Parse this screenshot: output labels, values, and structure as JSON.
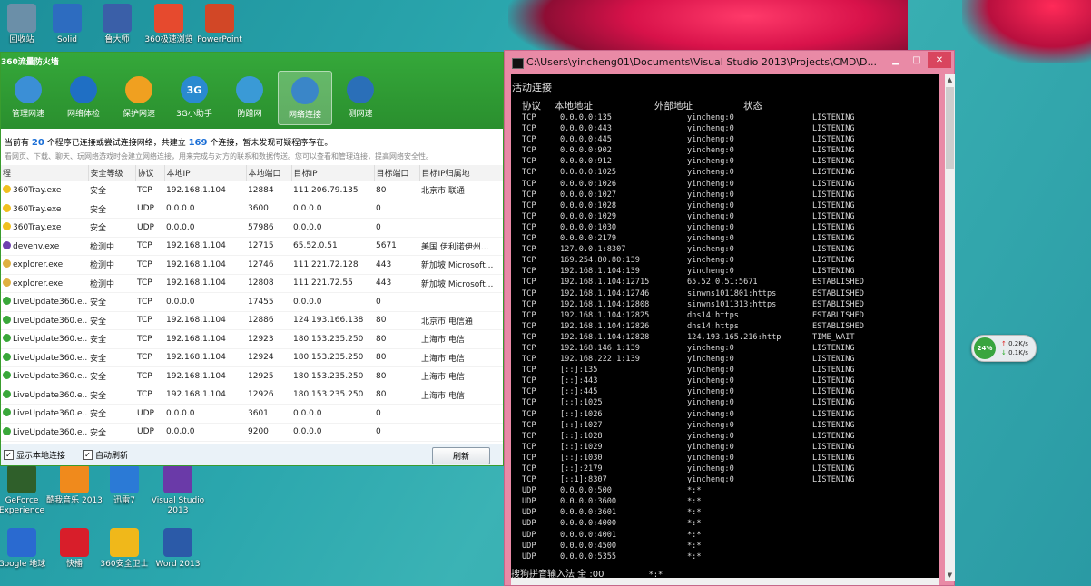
{
  "desktop_icons_top": [
    {
      "label": "回收站",
      "icon": "recycle-bin-icon",
      "color": "#6b8fa8"
    },
    {
      "label": "Solid",
      "icon": "solid-doc-icon",
      "color": "#2d6cc0"
    },
    {
      "label": "鲁大师",
      "icon": "ludashi-icon",
      "color": "#3a5fa8"
    },
    {
      "label": "360极速浏览",
      "icon": "browser-icon",
      "color": "#e64a2e"
    },
    {
      "label": "PowerPoint",
      "icon": "powerpoint-icon",
      "color": "#d24726"
    }
  ],
  "desktop_icons_bottom": [
    {
      "label": "GeForce Experience",
      "icon": "geforce-icon",
      "color": "#2f5f2a"
    },
    {
      "label": "酷我音乐 2013",
      "icon": "kuwo-icon",
      "color": "#f08a1c"
    },
    {
      "label": "迅雷7",
      "icon": "xunlei-icon",
      "color": "#2b7ad6"
    },
    {
      "label": "Visual Studio 2013",
      "icon": "visual-studio-icon",
      "color": "#6a3aa8"
    },
    {
      "label": "Google 地球",
      "icon": "google-earth-icon",
      "color": "#2a6ad0"
    },
    {
      "label": "快播",
      "icon": "kuaibo-icon",
      "color": "#d81e2a"
    },
    {
      "label": "360安全卫士",
      "icon": "360-security-icon",
      "color": "#f0b81a"
    },
    {
      "label": "Word 2013",
      "icon": "word-icon",
      "color": "#2b5aa8"
    }
  ],
  "firewall": {
    "title": "360流量防火墙",
    "tools": [
      {
        "label": "管理网速",
        "icon": "chart-icon",
        "active": false
      },
      {
        "label": "网络体检",
        "icon": "pulse-icon",
        "active": false
      },
      {
        "label": "保护网速",
        "icon": "lightning-shield-icon",
        "active": false
      },
      {
        "label": "3G小助手",
        "icon": "3g-icon",
        "text": "3G",
        "active": false
      },
      {
        "label": "防蹭网",
        "icon": "globe-shield-icon",
        "active": false
      },
      {
        "label": "网络连接",
        "icon": "network-monitor-icon",
        "active": true
      },
      {
        "label": "测网速",
        "icon": "speedometer-icon",
        "active": false
      }
    ],
    "info_prefix": "当前有",
    "program_count": "20",
    "info_mid": "个程序已连接或尝试连接网络，共建立",
    "connection_count": "169",
    "info_suffix": "个连接，暂未发现可疑程序存在。",
    "sub_info": "看网页、下载、聊天、玩网络游戏时会建立网络连接，用来完成与对方的联系和数据传送。您可以查看和管理连接，提高网络安全性。",
    "columns": [
      "程",
      "安全等级",
      "协议",
      "本地IP",
      "本地端口",
      "目标IP",
      "目标端口",
      "目标IP归属地"
    ],
    "rows": [
      {
        "program": "360Tray.exe",
        "level": "安全",
        "proto": "TCP",
        "local_ip": "192.168.1.104",
        "local_port": "12884",
        "remote_ip": "111.206.79.135",
        "remote_port": "80",
        "location": "北京市 联通",
        "icon_color": "#f0c020"
      },
      {
        "program": "360Tray.exe",
        "level": "安全",
        "proto": "UDP",
        "local_ip": "0.0.0.0",
        "local_port": "3600",
        "remote_ip": "0.0.0.0",
        "remote_port": "0",
        "location": "",
        "icon_color": "#f0c020"
      },
      {
        "program": "360Tray.exe",
        "level": "安全",
        "proto": "UDP",
        "local_ip": "0.0.0.0",
        "local_port": "57986",
        "remote_ip": "0.0.0.0",
        "remote_port": "0",
        "location": "",
        "icon_color": "#f0c020"
      },
      {
        "program": "devenv.exe",
        "level": "检测中",
        "proto": "TCP",
        "local_ip": "192.168.1.104",
        "local_port": "12715",
        "remote_ip": "65.52.0.51",
        "remote_port": "5671",
        "location": "美国 伊利诺伊州...",
        "icon_color": "#7040b0"
      },
      {
        "program": "explorer.exe",
        "level": "检测中",
        "proto": "TCP",
        "local_ip": "192.168.1.104",
        "local_port": "12746",
        "remote_ip": "111.221.72.128",
        "remote_port": "443",
        "location": "新加坡 Microsoft...",
        "icon_color": "#e0b040"
      },
      {
        "program": "explorer.exe",
        "level": "检测中",
        "proto": "TCP",
        "local_ip": "192.168.1.104",
        "local_port": "12808",
        "remote_ip": "111.221.72.55",
        "remote_port": "443",
        "location": "新加坡 Microsoft...",
        "icon_color": "#e0b040"
      },
      {
        "program": "LiveUpdate360.e...",
        "level": "安全",
        "proto": "TCP",
        "local_ip": "0.0.0.0",
        "local_port": "17455",
        "remote_ip": "0.0.0.0",
        "remote_port": "0",
        "location": "",
        "icon_color": "#3aa83a"
      },
      {
        "program": "LiveUpdate360.e...",
        "level": "安全",
        "proto": "TCP",
        "local_ip": "192.168.1.104",
        "local_port": "12886",
        "remote_ip": "124.193.166.138",
        "remote_port": "80",
        "location": "北京市 电信通",
        "icon_color": "#3aa83a"
      },
      {
        "program": "LiveUpdate360.e...",
        "level": "安全",
        "proto": "TCP",
        "local_ip": "192.168.1.104",
        "local_port": "12923",
        "remote_ip": "180.153.235.250",
        "remote_port": "80",
        "location": "上海市 电信",
        "icon_color": "#3aa83a"
      },
      {
        "program": "LiveUpdate360.e...",
        "level": "安全",
        "proto": "TCP",
        "local_ip": "192.168.1.104",
        "local_port": "12924",
        "remote_ip": "180.153.235.250",
        "remote_port": "80",
        "location": "上海市 电信",
        "icon_color": "#3aa83a"
      },
      {
        "program": "LiveUpdate360.e...",
        "level": "安全",
        "proto": "TCP",
        "local_ip": "192.168.1.104",
        "local_port": "12925",
        "remote_ip": "180.153.235.250",
        "remote_port": "80",
        "location": "上海市 电信",
        "icon_color": "#3aa83a"
      },
      {
        "program": "LiveUpdate360.e...",
        "level": "安全",
        "proto": "TCP",
        "local_ip": "192.168.1.104",
        "local_port": "12926",
        "remote_ip": "180.153.235.250",
        "remote_port": "80",
        "location": "上海市 电信",
        "icon_color": "#3aa83a"
      },
      {
        "program": "LiveUpdate360.e...",
        "level": "安全",
        "proto": "UDP",
        "local_ip": "0.0.0.0",
        "local_port": "3601",
        "remote_ip": "0.0.0.0",
        "remote_port": "0",
        "location": "",
        "icon_color": "#3aa83a"
      },
      {
        "program": "LiveUpdate360.e...",
        "level": "安全",
        "proto": "UDP",
        "local_ip": "0.0.0.0",
        "local_port": "9200",
        "remote_ip": "0.0.0.0",
        "remote_port": "0",
        "location": "",
        "icon_color": "#3aa83a"
      }
    ],
    "show_local_label": "显示本地连接",
    "auto_refresh_label": "自动刷新",
    "refresh_label": "刷新"
  },
  "cmd": {
    "title": "C:\\Users\\yincheng01\\Documents\\Visual Studio 2013\\Projects\\CMD\\D...",
    "heading": "活动连接",
    "col_headers": {
      "proto": "协议",
      "local": "本地地址",
      "foreign": "外部地址",
      "state": "状态"
    },
    "lines": [
      [
        "TCP",
        "0.0.0.0:135",
        "yincheng:0",
        "LISTENING"
      ],
      [
        "TCP",
        "0.0.0.0:443",
        "yincheng:0",
        "LISTENING"
      ],
      [
        "TCP",
        "0.0.0.0:445",
        "yincheng:0",
        "LISTENING"
      ],
      [
        "TCP",
        "0.0.0.0:902",
        "yincheng:0",
        "LISTENING"
      ],
      [
        "TCP",
        "0.0.0.0:912",
        "yincheng:0",
        "LISTENING"
      ],
      [
        "TCP",
        "0.0.0.0:1025",
        "yincheng:0",
        "LISTENING"
      ],
      [
        "TCP",
        "0.0.0.0:1026",
        "yincheng:0",
        "LISTENING"
      ],
      [
        "TCP",
        "0.0.0.0:1027",
        "yincheng:0",
        "LISTENING"
      ],
      [
        "TCP",
        "0.0.0.0:1028",
        "yincheng:0",
        "LISTENING"
      ],
      [
        "TCP",
        "0.0.0.0:1029",
        "yincheng:0",
        "LISTENING"
      ],
      [
        "TCP",
        "0.0.0.0:1030",
        "yincheng:0",
        "LISTENING"
      ],
      [
        "TCP",
        "0.0.0.0:2179",
        "yincheng:0",
        "LISTENING"
      ],
      [
        "TCP",
        "127.0.0.1:8307",
        "yincheng:0",
        "LISTENING"
      ],
      [
        "TCP",
        "169.254.80.80:139",
        "yincheng:0",
        "LISTENING"
      ],
      [
        "TCP",
        "192.168.1.104:139",
        "yincheng:0",
        "LISTENING"
      ],
      [
        "TCP",
        "192.168.1.104:12715",
        "65.52.0.51:5671",
        "ESTABLISHED"
      ],
      [
        "TCP",
        "192.168.1.104:12746",
        "sinwns1011801:https",
        "ESTABLISHED"
      ],
      [
        "TCP",
        "192.168.1.104:12808",
        "sinwns1011313:https",
        "ESTABLISHED"
      ],
      [
        "TCP",
        "192.168.1.104:12825",
        "dns14:https",
        "ESTABLISHED"
      ],
      [
        "TCP",
        "192.168.1.104:12826",
        "dns14:https",
        "ESTABLISHED"
      ],
      [
        "TCP",
        "192.168.1.104:12828",
        "124.193.165.216:http",
        "TIME_WAIT"
      ],
      [
        "TCP",
        "192.168.146.1:139",
        "yincheng:0",
        "LISTENING"
      ],
      [
        "TCP",
        "192.168.222.1:139",
        "yincheng:0",
        "LISTENING"
      ],
      [
        "TCP",
        "[::]:135",
        "yincheng:0",
        "LISTENING"
      ],
      [
        "TCP",
        "[::]:443",
        "yincheng:0",
        "LISTENING"
      ],
      [
        "TCP",
        "[::]:445",
        "yincheng:0",
        "LISTENING"
      ],
      [
        "TCP",
        "[::]:1025",
        "yincheng:0",
        "LISTENING"
      ],
      [
        "TCP",
        "[::]:1026",
        "yincheng:0",
        "LISTENING"
      ],
      [
        "TCP",
        "[::]:1027",
        "yincheng:0",
        "LISTENING"
      ],
      [
        "TCP",
        "[::]:1028",
        "yincheng:0",
        "LISTENING"
      ],
      [
        "TCP",
        "[::]:1029",
        "yincheng:0",
        "LISTENING"
      ],
      [
        "TCP",
        "[::]:1030",
        "yincheng:0",
        "LISTENING"
      ],
      [
        "TCP",
        "[::]:2179",
        "yincheng:0",
        "LISTENING"
      ],
      [
        "TCP",
        "[::1]:8307",
        "yincheng:0",
        "LISTENING"
      ],
      [
        "UDP",
        "0.0.0.0:500",
        "*:*",
        ""
      ],
      [
        "UDP",
        "0.0.0.0:3600",
        "*:*",
        ""
      ],
      [
        "UDP",
        "0.0.0.0:3601",
        "*:*",
        ""
      ],
      [
        "UDP",
        "0.0.0.0:4000",
        "*:*",
        ""
      ],
      [
        "UDP",
        "0.0.0.0:4001",
        "*:*",
        ""
      ],
      [
        "UDP",
        "0.0.0.0:4500",
        "*:*",
        ""
      ],
      [
        "UDP",
        "0.0.0.0:5355",
        "*:*",
        ""
      ]
    ],
    "ime_status": "搜狗拼音输入法 全 :00",
    "last_foreign": "*:*"
  },
  "speed_widget": {
    "percent": "24%",
    "upload": "0.2K/s",
    "download": "0.1K/s"
  }
}
